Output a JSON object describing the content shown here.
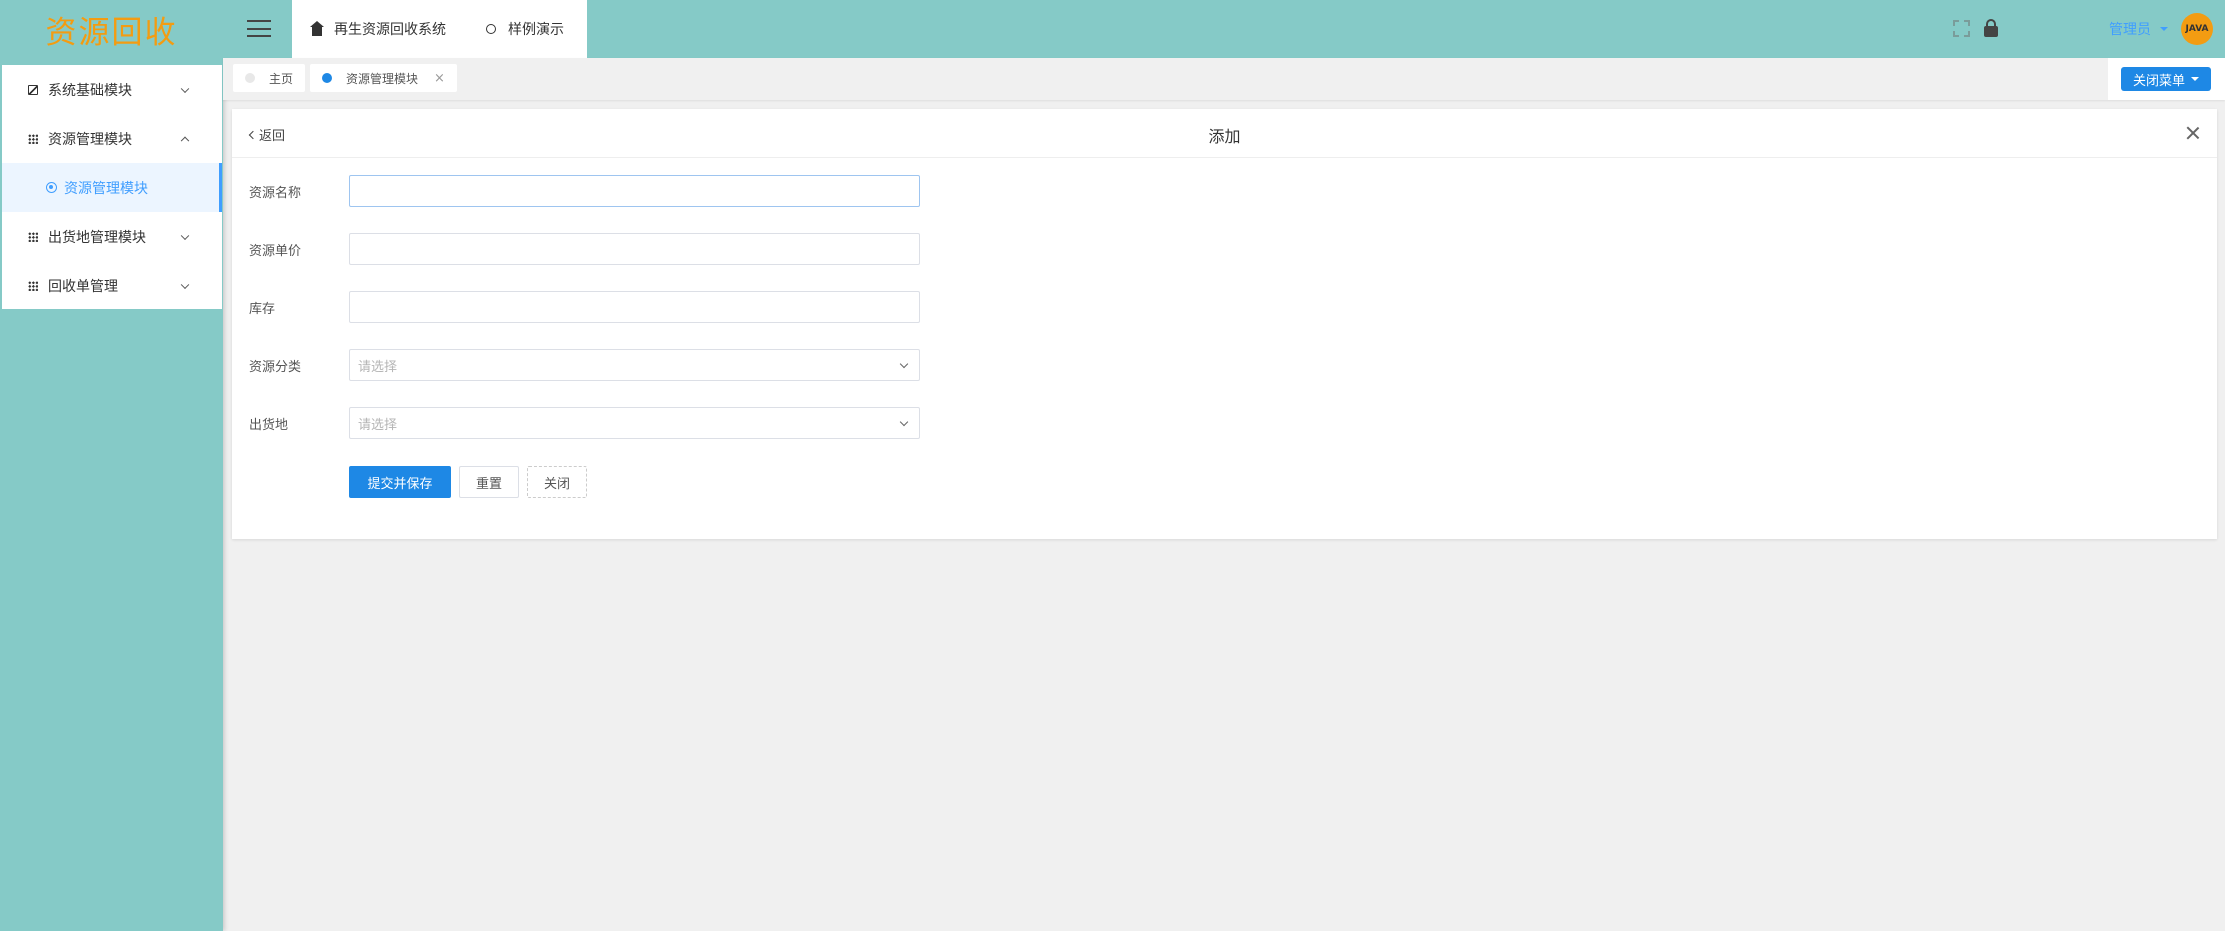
{
  "sidebar": {
    "logo": "资源回收",
    "items": [
      {
        "label": "系统基础模块",
        "icon": "chart-icon",
        "expanded": false
      },
      {
        "label": "资源管理模块",
        "icon": "grid-icon",
        "expanded": true
      },
      {
        "label": "资源管理模块",
        "icon": "ring-icon",
        "sub": true,
        "active": true
      },
      {
        "label": "出货地管理模块",
        "icon": "grid-icon",
        "expanded": false
      },
      {
        "label": "回收单管理",
        "icon": "grid-icon",
        "expanded": false
      }
    ]
  },
  "topbar": {
    "tabs": [
      {
        "label": "再生资源回收系统",
        "icon": "home-icon"
      },
      {
        "label": "样例演示",
        "icon": "bulb-icon"
      }
    ],
    "user": "管理员",
    "avatar_text": "JAVA"
  },
  "tagbar": {
    "tags": [
      {
        "label": "主页",
        "active": false
      },
      {
        "label": "资源管理模块",
        "active": true
      }
    ],
    "close_menu": "关闭菜单"
  },
  "form": {
    "back": "返回",
    "title": "添加",
    "fields": [
      {
        "label": "资源名称",
        "value": ""
      },
      {
        "label": "资源单价",
        "value": ""
      },
      {
        "label": "库存",
        "value": ""
      }
    ],
    "selects": [
      {
        "label": "资源分类",
        "placeholder": "请选择"
      },
      {
        "label": "出货地",
        "placeholder": "请选择"
      }
    ],
    "buttons": {
      "submit": "提交并保存",
      "reset": "重置",
      "close": "关闭"
    }
  },
  "colors": {
    "teal": "#85cac7",
    "primary": "#1e88e5",
    "accent": "#409eff",
    "logo": "#f39c12"
  }
}
